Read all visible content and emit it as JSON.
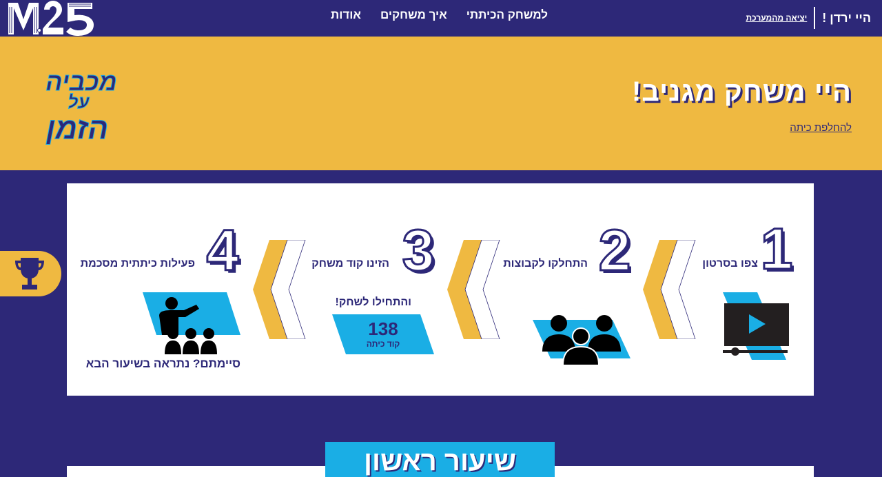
{
  "header": {
    "logo_text": "M25",
    "nav": [
      {
        "label": "למשחק הכיתתי"
      },
      {
        "label": "איך משחקים"
      },
      {
        "label": "אודות"
      }
    ],
    "greeting": "היי ירדן !",
    "logout": "יציאה מהמערכת"
  },
  "banner": {
    "title": "היי משחק מגניב!",
    "switch_class": "להחלפת כיתה",
    "game_logo_lines": [
      "מכביה",
      "על",
      "הזמן"
    ]
  },
  "steps": [
    {
      "number": "1",
      "label": "צפו בסרטון",
      "icon": "video-player-icon"
    },
    {
      "number": "2",
      "label": "התחלקו לקבוצות",
      "icon": "group-icon"
    },
    {
      "number": "3",
      "label": "הזינו קוד משחק",
      "sublabel": "והתחילו לשחק!",
      "code": "138",
      "code_caption": "קוד כיתה"
    },
    {
      "number": "4",
      "label": "פעילות כיתתית מסכמת",
      "icon": "teacher-class-icon",
      "footer": "סיימתם? נתראה בשיעור הבא"
    }
  ],
  "lesson": {
    "title": "שיעור ראשון"
  },
  "colors": {
    "navy": "#2d2878",
    "yellow": "#efb941",
    "cyan": "#1aaee5",
    "white": "#ffffff"
  }
}
